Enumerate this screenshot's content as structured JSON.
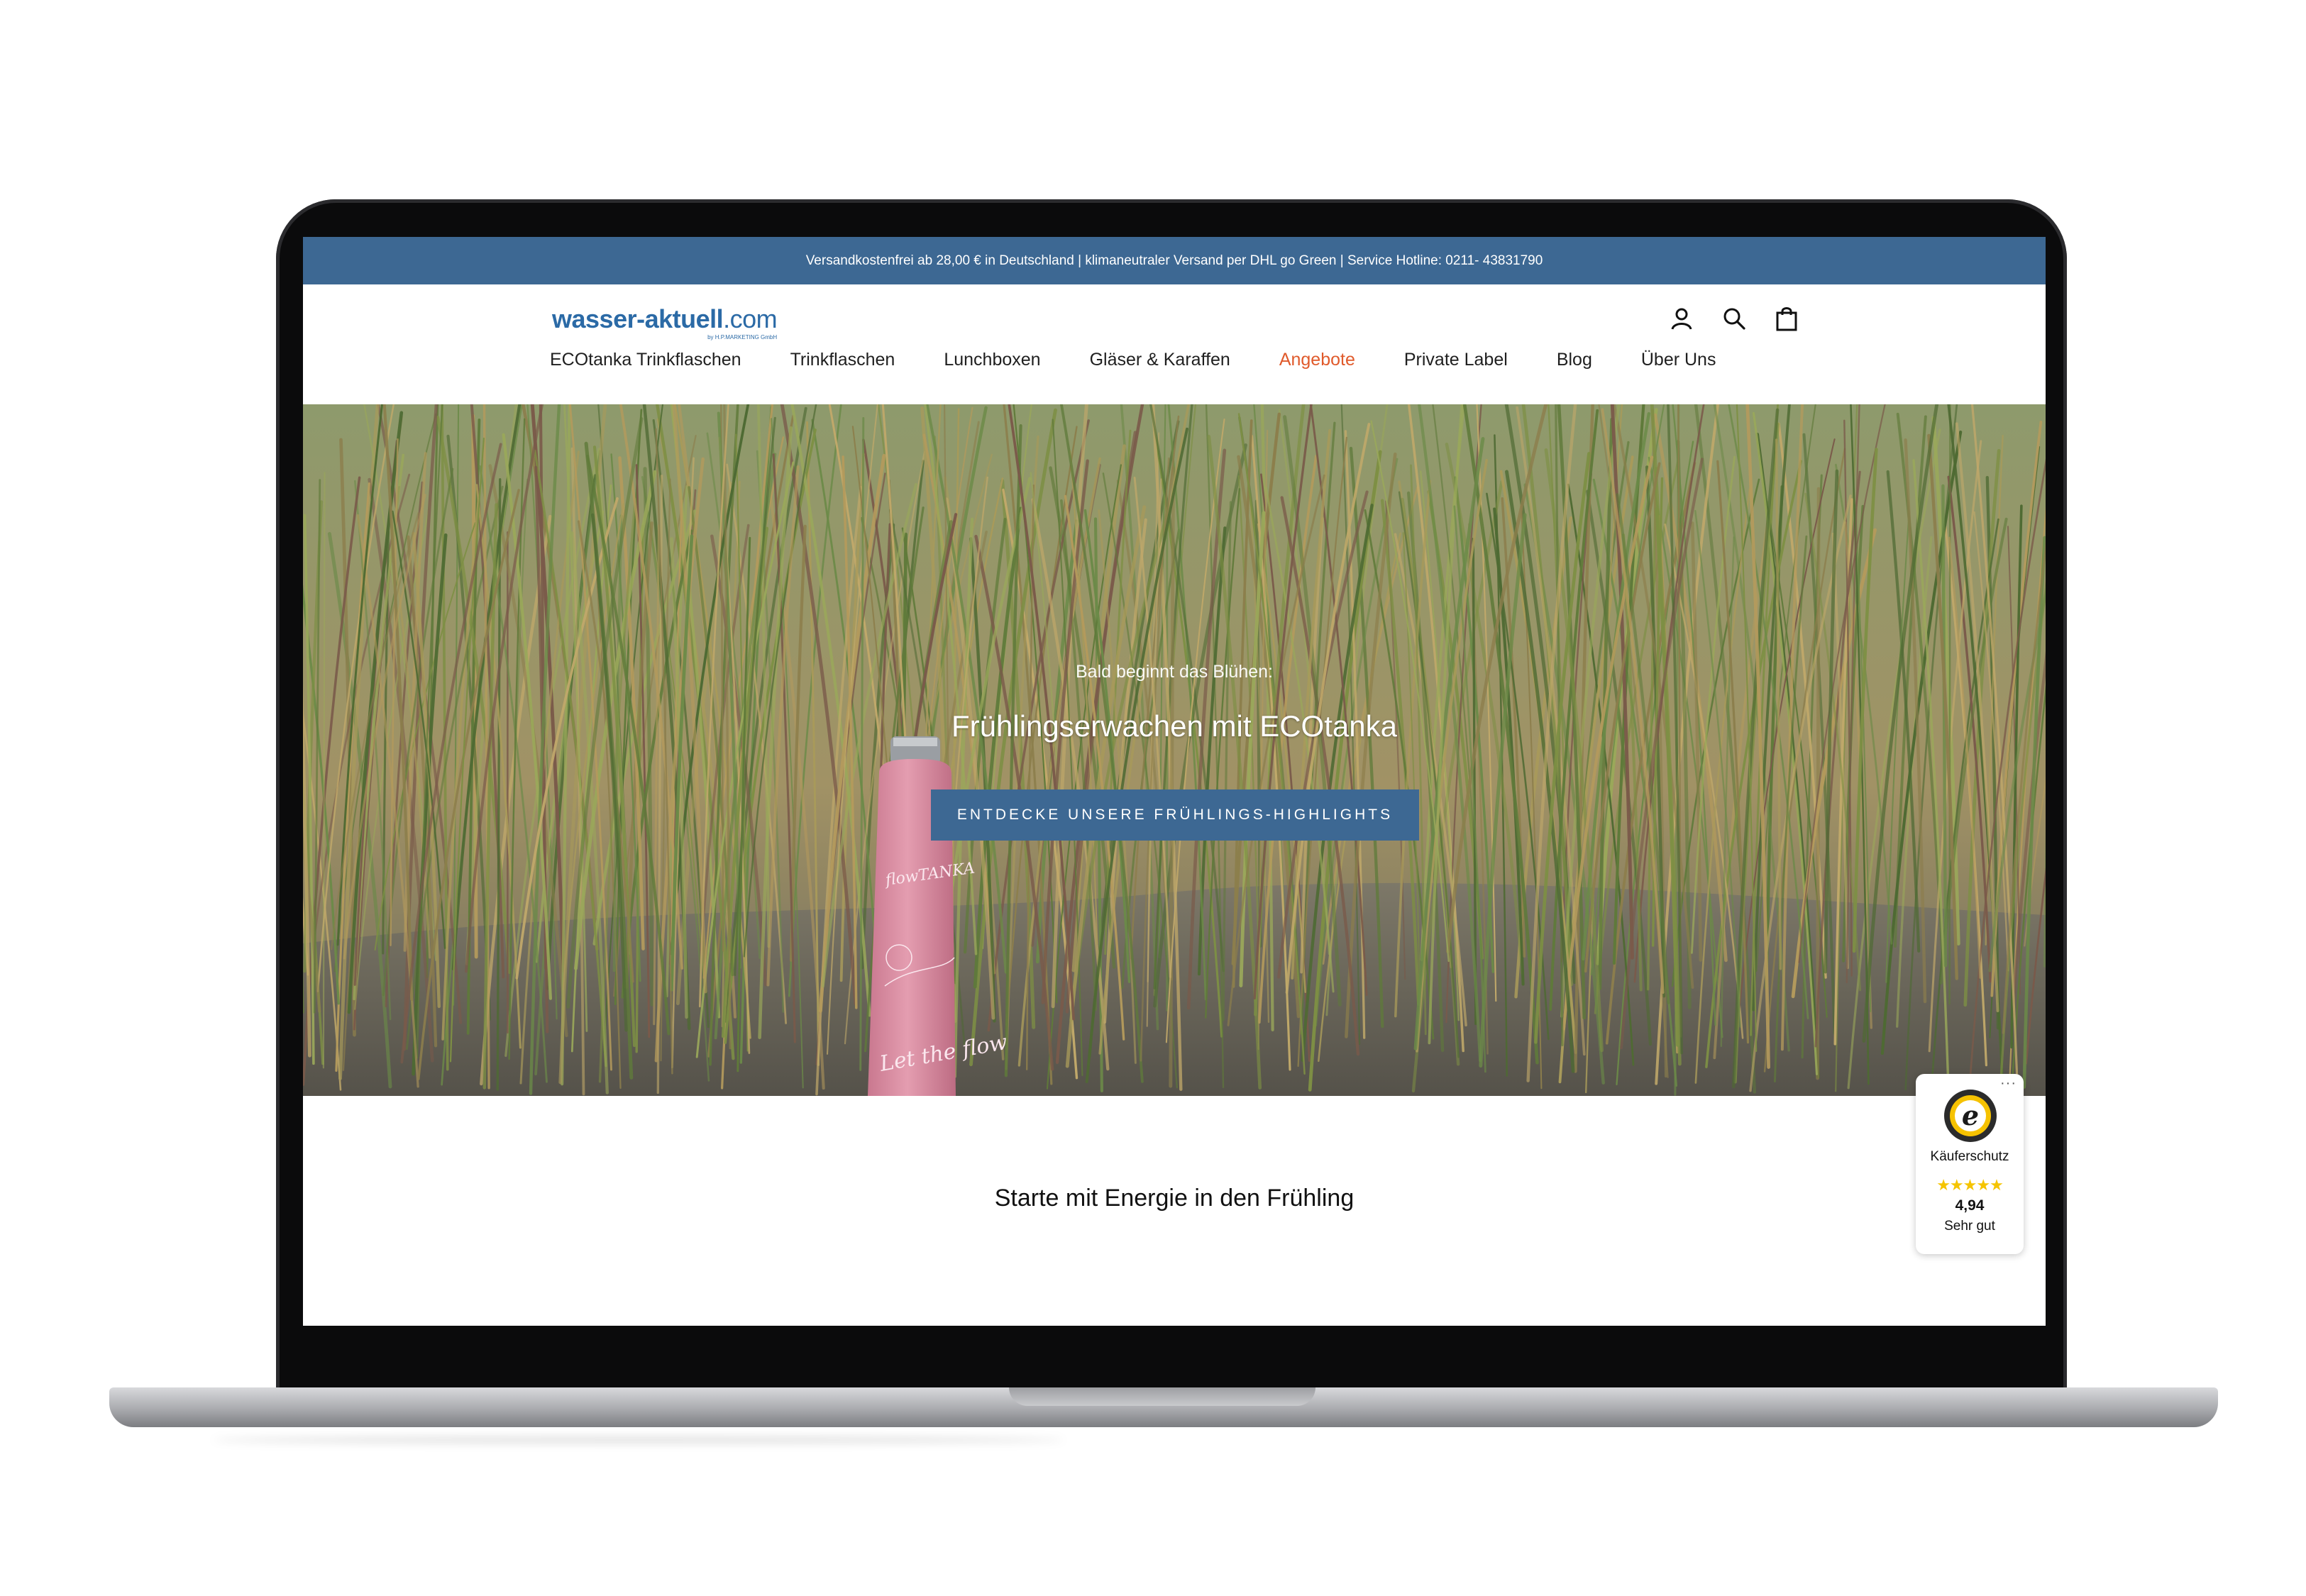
{
  "announcement": "Versandkostenfrei ab 28,00 € in Deutschland | klimaneutraler Versand per DHL go Green | Service Hotline: 0211- 43831790",
  "logo": {
    "name": "wasser-aktuell",
    "tld": ".com",
    "tagline": "by H.P.MARKETING GmbH"
  },
  "header_icons": [
    "account-icon",
    "search-icon",
    "shopping-bag-icon"
  ],
  "nav": [
    {
      "label": "ECOtanka Trinkflaschen"
    },
    {
      "label": "Trinkflaschen"
    },
    {
      "label": "Lunchboxen"
    },
    {
      "label": "Gläser & Karaffen"
    },
    {
      "label": "Angebote"
    },
    {
      "label": "Private Label"
    },
    {
      "label": "Blog"
    },
    {
      "label": "Über Uns"
    }
  ],
  "colors": {
    "brand_blue": "#3d6893",
    "nav_highlight": "#e05a2b",
    "stars": "#f5c400"
  },
  "hero": {
    "subtitle": "Bald beginnt das Blühen:",
    "title": "Frühlingserwachen mit ECOtanka",
    "button": "ENTDECKE UNSERE FRÜHLINGS-HIGHLIGHTS",
    "bottle_brand": "flowTANKA",
    "bottle_text": "Let the flow"
  },
  "section_title": "Starte mit Energie in den Frühling",
  "trust_badge": {
    "label": "Käuferschutz",
    "stars": "★★★★★",
    "score": "4,94",
    "rating_text": "Sehr gut",
    "menu": "···",
    "seal_letter": "e"
  }
}
